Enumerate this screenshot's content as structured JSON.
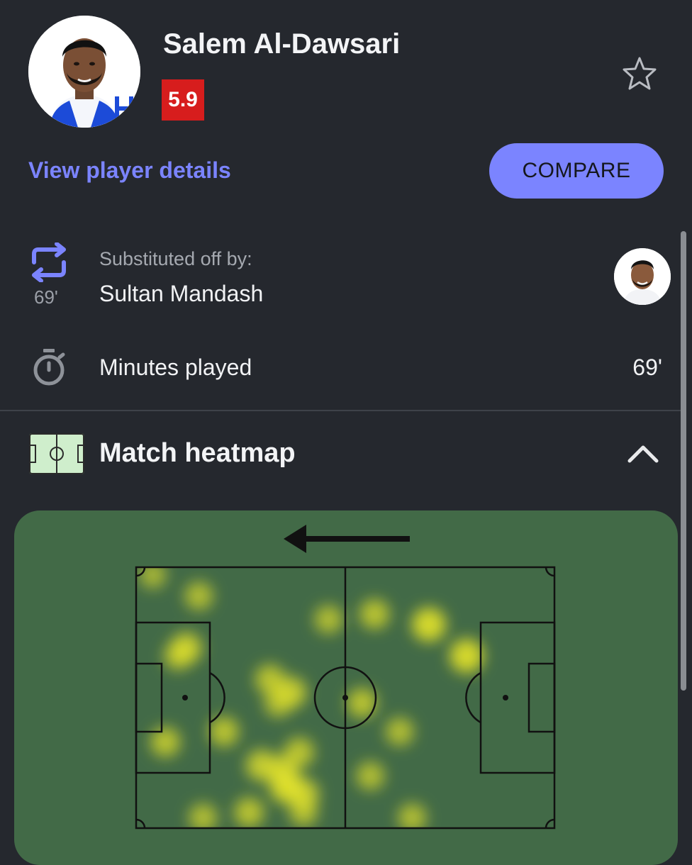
{
  "player": {
    "name": "Salem Al-Dawsari",
    "rating": "5.9",
    "rating_color": "#d71d1d",
    "avatar_icon": "player-photo",
    "club_badge": "H",
    "favorite_icon": "star-outline-icon"
  },
  "actions": {
    "view_details_label": "View player details",
    "compare_label": "COMPARE",
    "accent_color": "#7b84ff"
  },
  "substitution": {
    "icon": "swap-arrows-icon",
    "minute": "69'",
    "label": "Substituted off by:",
    "player_name": "Sultan Mandash",
    "avatar_icon": "player-photo"
  },
  "minutes": {
    "icon": "stopwatch-icon",
    "label": "Minutes played",
    "value": "69'"
  },
  "heatmap": {
    "icon": "pitch-icon",
    "title": "Match heatmap",
    "expanded": true,
    "direction_icon": "arrow-left-icon",
    "pitch_color": "#426a47",
    "heat_color": "#e3e32a",
    "points": [
      {
        "x": 0.04,
        "y": 0.03,
        "w": 0.5
      },
      {
        "x": 0.15,
        "y": 0.11,
        "w": 0.6
      },
      {
        "x": 0.12,
        "y": 0.31,
        "w": 0.8
      },
      {
        "x": 0.1,
        "y": 0.34,
        "w": 0.6
      },
      {
        "x": 0.46,
        "y": 0.2,
        "w": 0.6
      },
      {
        "x": 0.57,
        "y": 0.18,
        "w": 0.7
      },
      {
        "x": 0.7,
        "y": 0.22,
        "w": 1.0
      },
      {
        "x": 0.79,
        "y": 0.34,
        "w": 1.0
      },
      {
        "x": 0.32,
        "y": 0.43,
        "w": 0.7
      },
      {
        "x": 0.37,
        "y": 0.48,
        "w": 0.8
      },
      {
        "x": 0.34,
        "y": 0.52,
        "w": 0.6
      },
      {
        "x": 0.54,
        "y": 0.52,
        "w": 0.7
      },
      {
        "x": 0.63,
        "y": 0.63,
        "w": 0.6
      },
      {
        "x": 0.21,
        "y": 0.63,
        "w": 0.7
      },
      {
        "x": 0.07,
        "y": 0.67,
        "w": 0.7
      },
      {
        "x": 0.39,
        "y": 0.71,
        "w": 0.7
      },
      {
        "x": 0.3,
        "y": 0.76,
        "w": 0.8
      },
      {
        "x": 0.35,
        "y": 0.78,
        "w": 0.8
      },
      {
        "x": 0.36,
        "y": 0.84,
        "w": 1.0
      },
      {
        "x": 0.4,
        "y": 0.87,
        "w": 0.8
      },
      {
        "x": 0.56,
        "y": 0.8,
        "w": 0.6
      },
      {
        "x": 0.4,
        "y": 0.94,
        "w": 0.6
      },
      {
        "x": 0.27,
        "y": 0.94,
        "w": 0.7
      },
      {
        "x": 0.16,
        "y": 0.96,
        "w": 0.6
      },
      {
        "x": 0.66,
        "y": 0.96,
        "w": 0.6
      }
    ]
  }
}
